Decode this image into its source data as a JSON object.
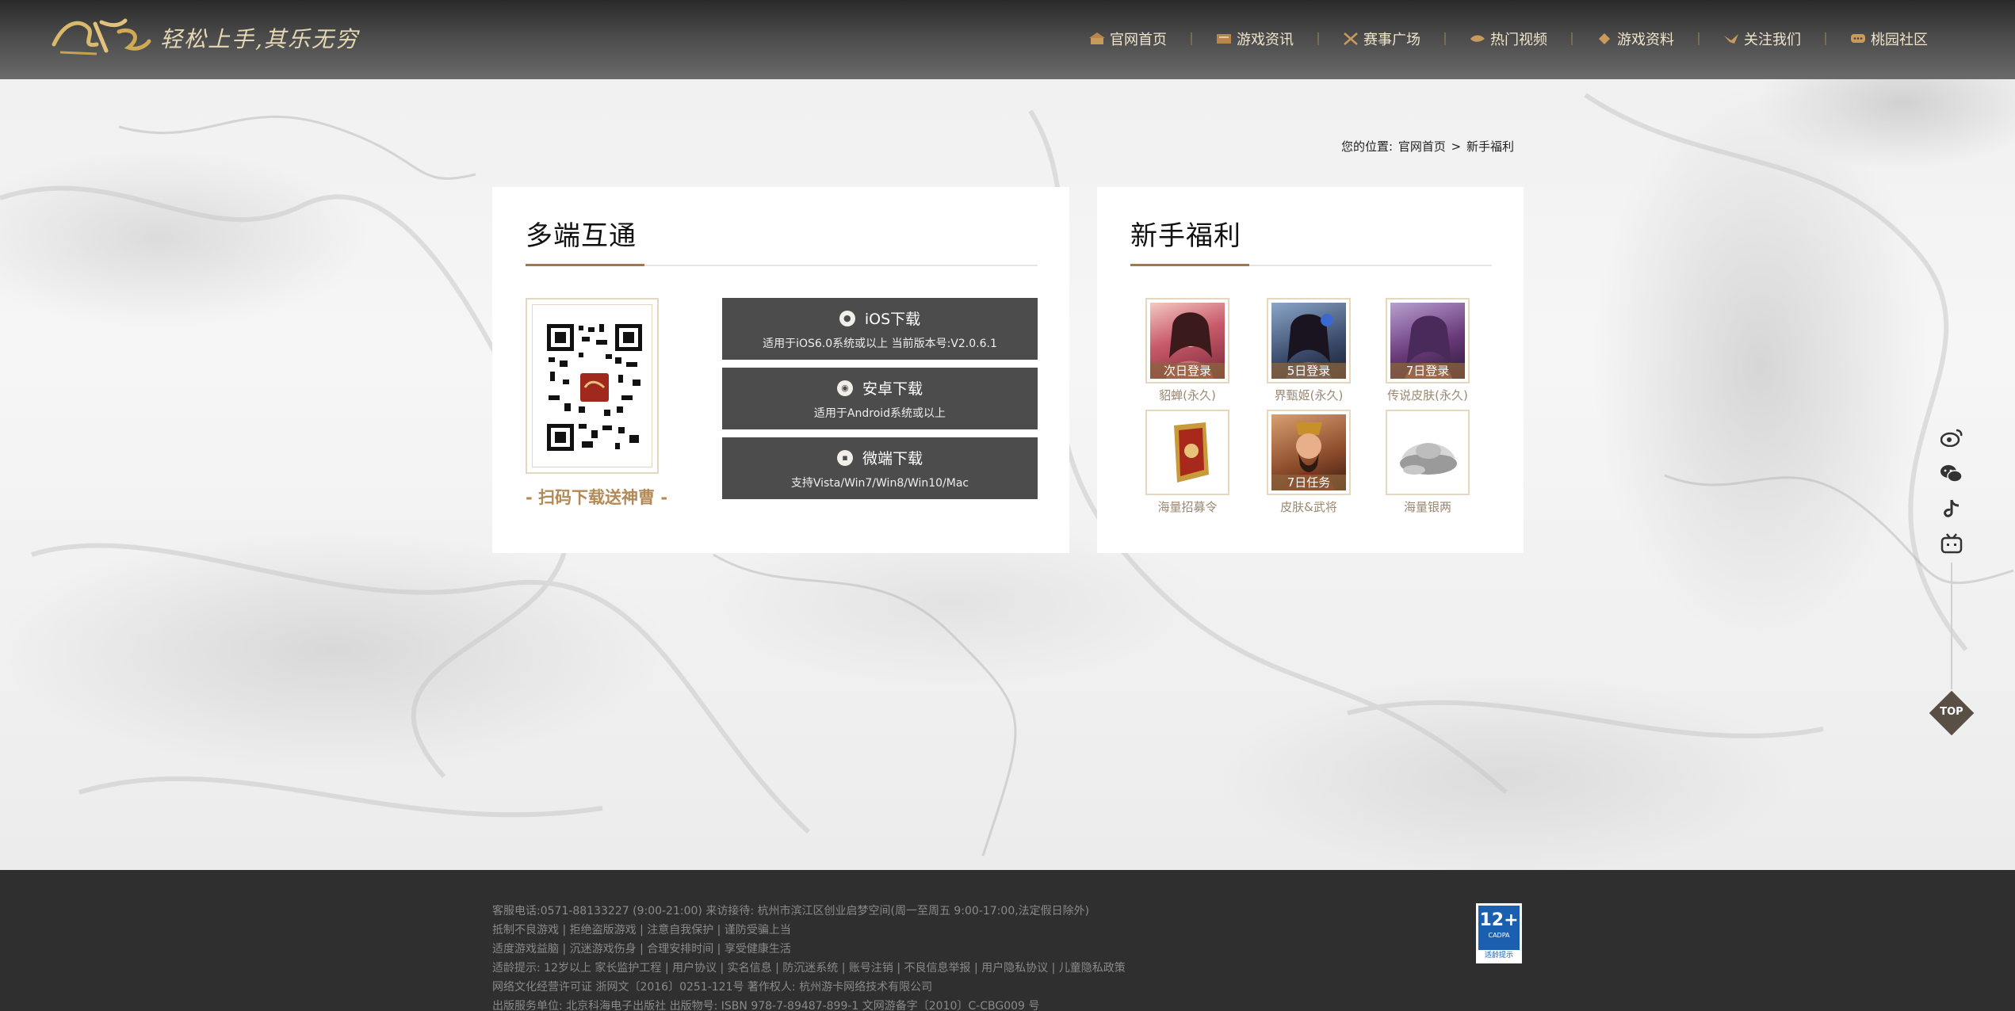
{
  "header": {
    "logo_text": "三国杀",
    "slogan": "轻松上手,其乐无穷",
    "nav": [
      {
        "label": "官网首页",
        "icon": "home-icon"
      },
      {
        "label": "游戏资讯",
        "icon": "news-icon"
      },
      {
        "label": "赛事广场",
        "icon": "swords-icon"
      },
      {
        "label": "热门视频",
        "icon": "video-icon"
      },
      {
        "label": "游戏资料",
        "icon": "book-icon"
      },
      {
        "label": "关注我们",
        "icon": "bird-icon"
      },
      {
        "label": "桃园社区",
        "icon": "chat-icon"
      }
    ]
  },
  "breadcrumb": {
    "prefix": "您的位置:",
    "home": "官网首页",
    "sep": ">",
    "current": "新手福利"
  },
  "download": {
    "title": "多端互通",
    "qr_caption": "- 扫码下载送神曹 -",
    "buttons": [
      {
        "title": "iOS下载",
        "desc": "适用于iOS6.0系统或以上 当前版本号:V2.0.6.1",
        "icon": "apple-icon"
      },
      {
        "title": "安卓下载",
        "desc": "适用于Android系统或以上",
        "icon": "android-icon"
      },
      {
        "title": "微端下载",
        "desc": "支持Vista/Win7/Win8/Win10/Mac",
        "icon": "pc-icon"
      }
    ]
  },
  "rewards": {
    "title": "新手福利",
    "items": [
      {
        "tag": "次日登录",
        "label": "貂蝉(永久)"
      },
      {
        "tag": "5日登录",
        "label": "界甄姬(永久)"
      },
      {
        "tag": "7日登录",
        "label": "传说皮肤(永久)"
      },
      {
        "tag": "",
        "label": "海量招募令"
      },
      {
        "tag": "7日任务",
        "label": "皮肤&武将"
      },
      {
        "tag": "",
        "label": "海量银两"
      }
    ]
  },
  "side": {
    "icons": [
      "weibo-icon",
      "wechat-icon",
      "douyin-icon",
      "bilibili-icon"
    ],
    "top_label": "TOP"
  },
  "footer": {
    "lines": [
      "客服电话:0571-88133227 (9:00-21:00) 来访接待: 杭州市滨江区创业启梦空间(周一至周五 9:00-17:00,法定假日除外)",
      "抵制不良游戏 | 拒绝盗版游戏 | 注意自我保护 | 谨防受骗上当",
      "适度游戏益脑 | 沉迷游戏伤身 | 合理安排时间 | 享受健康生活",
      "适龄提示: 12岁以上 家长监护工程 | 用户协议 | 实名信息 | 防沉迷系统 | 账号注销 | 不良信息举报 | 用户隐私协议 | 儿童隐私政策",
      "网络文化经营许可证 浙网文〔2016〕0251-121号 著作权人: 杭州游卡网络技术有限公司",
      "出版服务单位: 北京科海电子出版社 出版物号: ISBN 978-7-89487-899-1 文网游备字〔2010〕C-CBG009 号"
    ],
    "age_badge": {
      "num": "12+",
      "org": "CADPA",
      "tip": "适龄提示"
    }
  }
}
